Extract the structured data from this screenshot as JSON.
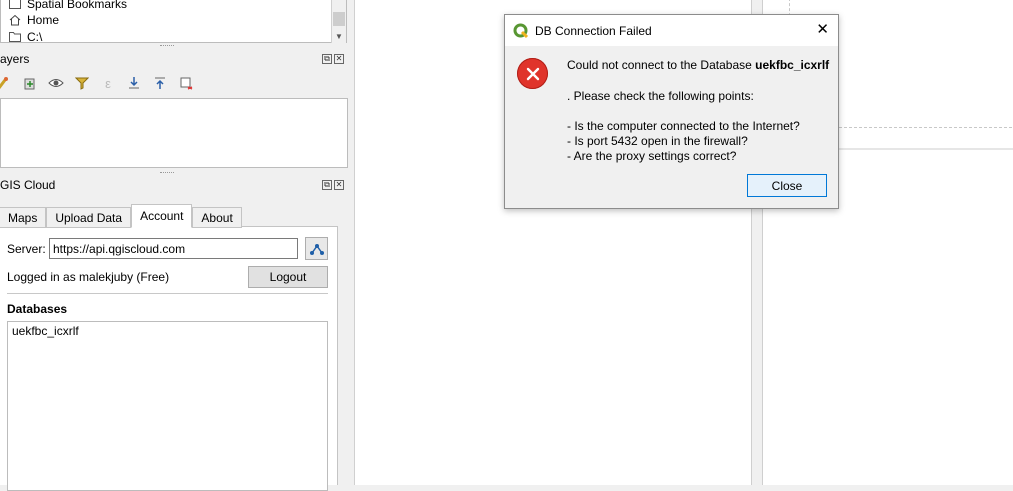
{
  "browser": {
    "items": [
      {
        "label": "Spatial Bookmarks",
        "icon": "bookmark-icon"
      },
      {
        "label": "Home",
        "icon": "home-icon"
      },
      {
        "label": "C:\\",
        "icon": "folder-icon"
      }
    ]
  },
  "layers_panel": {
    "title": "ayers"
  },
  "cloud_panel": {
    "title": "GIS Cloud",
    "tabs": [
      {
        "label": "Maps"
      },
      {
        "label": "Upload Data"
      },
      {
        "label": "Account",
        "active": true
      },
      {
        "label": "About"
      }
    ],
    "server_label": "Server:",
    "server_value": "https://api.qgiscloud.com",
    "logged_in_text": "Logged in as malekjuby (Free)",
    "logout_label": "Logout",
    "databases_label": "Databases",
    "databases": [
      "uekfbc_icxrlf"
    ]
  },
  "dialog": {
    "title": "DB Connection Failed",
    "line1_prefix": "Could not connect to the Database ",
    "line1_db": "uekfbc_icxrlf",
    "line2": ". Please check the following points:",
    "points": [
      "- Is the computer connected to the Internet?",
      "- Is port 5432 open in the firewall?",
      "- Are the proxy settings correct?"
    ],
    "close_button": "Close",
    "close_glyph": "✕"
  },
  "colors": {
    "accent": "#1f5fa8",
    "error": "#e0342b",
    "qgis_green": "#589632"
  }
}
